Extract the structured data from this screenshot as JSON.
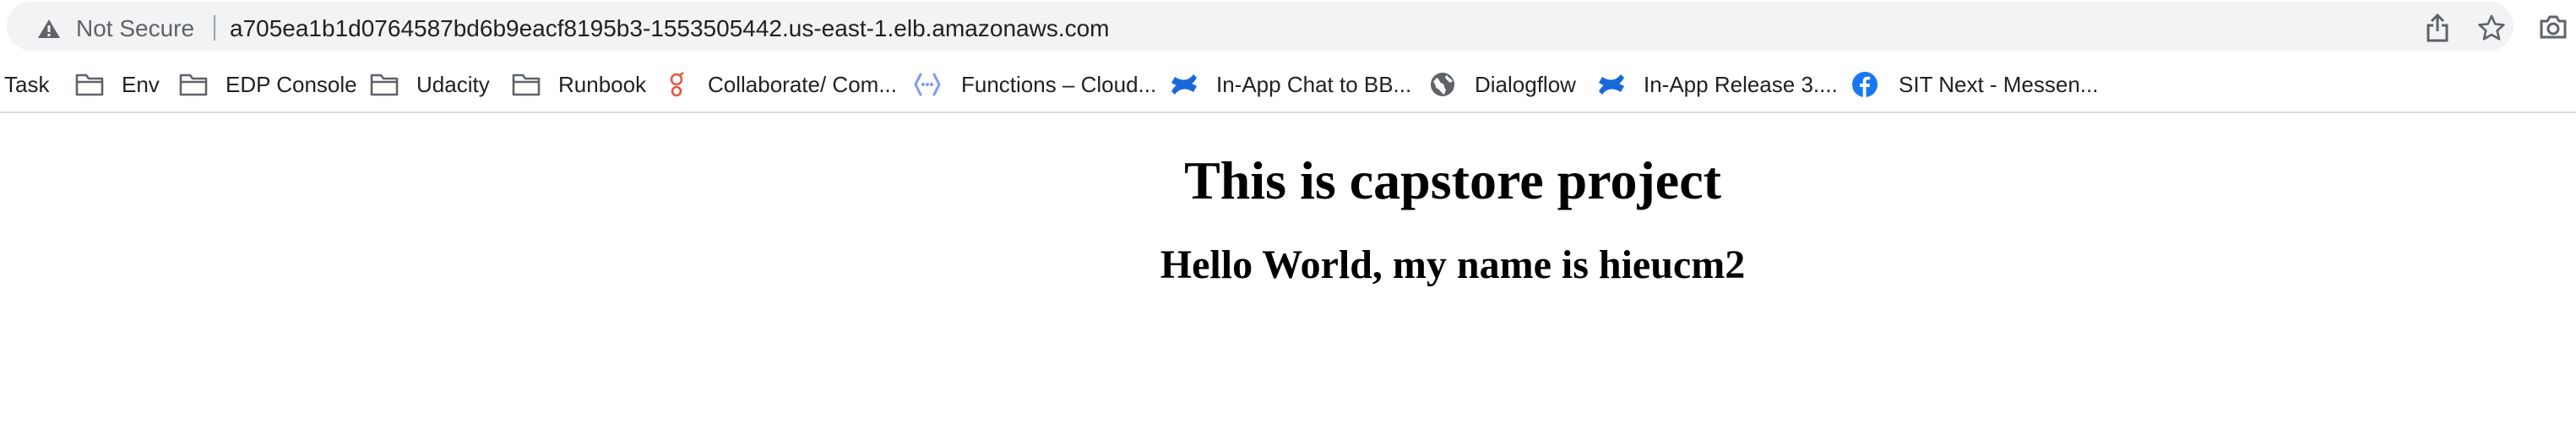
{
  "address_bar": {
    "security_label": "Not Secure",
    "url": "a705ea1b1d0764587bd6b9eacf8195b3-1553505442.us-east-1.elb.amazonaws.com"
  },
  "bookmarks": [
    {
      "label": "Task",
      "icon": "none"
    },
    {
      "label": "Env",
      "icon": "folder-icon"
    },
    {
      "label": "EDP Console",
      "icon": "folder-icon"
    },
    {
      "label": "Udacity",
      "icon": "folder-icon"
    },
    {
      "label": "Runbook",
      "icon": "folder-icon"
    },
    {
      "label": "Collaborate/ Com...",
      "icon": "gerrit-icon"
    },
    {
      "label": "Functions – Cloud...",
      "icon": "cloud-functions-icon"
    },
    {
      "label": "In-App Chat to BB...",
      "icon": "confluence-icon"
    },
    {
      "label": "Dialogflow",
      "icon": "globe-icon"
    },
    {
      "label": "In-App Release 3....",
      "icon": "confluence-icon"
    },
    {
      "label": "SIT Next - Messen...",
      "icon": "facebook-icon"
    }
  ],
  "page": {
    "heading": "This is capstore project",
    "subheading": "Hello World, my name is hieucm2"
  },
  "colors": {
    "omnibox_bg": "#f1f3f4",
    "confluence_blue": "#1868db",
    "facebook_blue": "#1877f2",
    "gerrit_red": "#e8573f",
    "cloud_functions_blue": "#7b9cf5"
  }
}
